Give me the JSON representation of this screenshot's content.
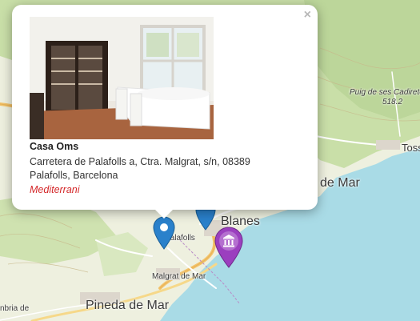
{
  "map": {
    "places": {
      "puig": "Puig de ses Cadiretes",
      "puig_elev": "518.2",
      "tossa": "Toss",
      "sea_label": "de Mar",
      "blanes": "Blanes",
      "palafolls": "Palafolls",
      "malgrat": "Malgrat de Mar",
      "pineda": "Pineda de Mar",
      "calella_fragment": "nbria de"
    }
  },
  "popup": {
    "close_label": "×",
    "name": "Casa Oms",
    "address_line1": "Carretera de Palafolls a, Ctra. Malgrat, s/n, 08389",
    "address_line2": "Palafolls, Barcelona",
    "cuisine": "Mediterrani"
  },
  "markers": [
    {
      "icon": "restaurant-marker-icon",
      "color": "#2a81cb"
    },
    {
      "icon": "museum-marker-icon",
      "color": "#9b3fbf"
    }
  ],
  "colors": {
    "sea": "#a9dbe6",
    "land": "#eef0df",
    "forest": "#c9dfa8",
    "road_major": "#f3c36b",
    "cuisine_text": "#d4282a"
  }
}
